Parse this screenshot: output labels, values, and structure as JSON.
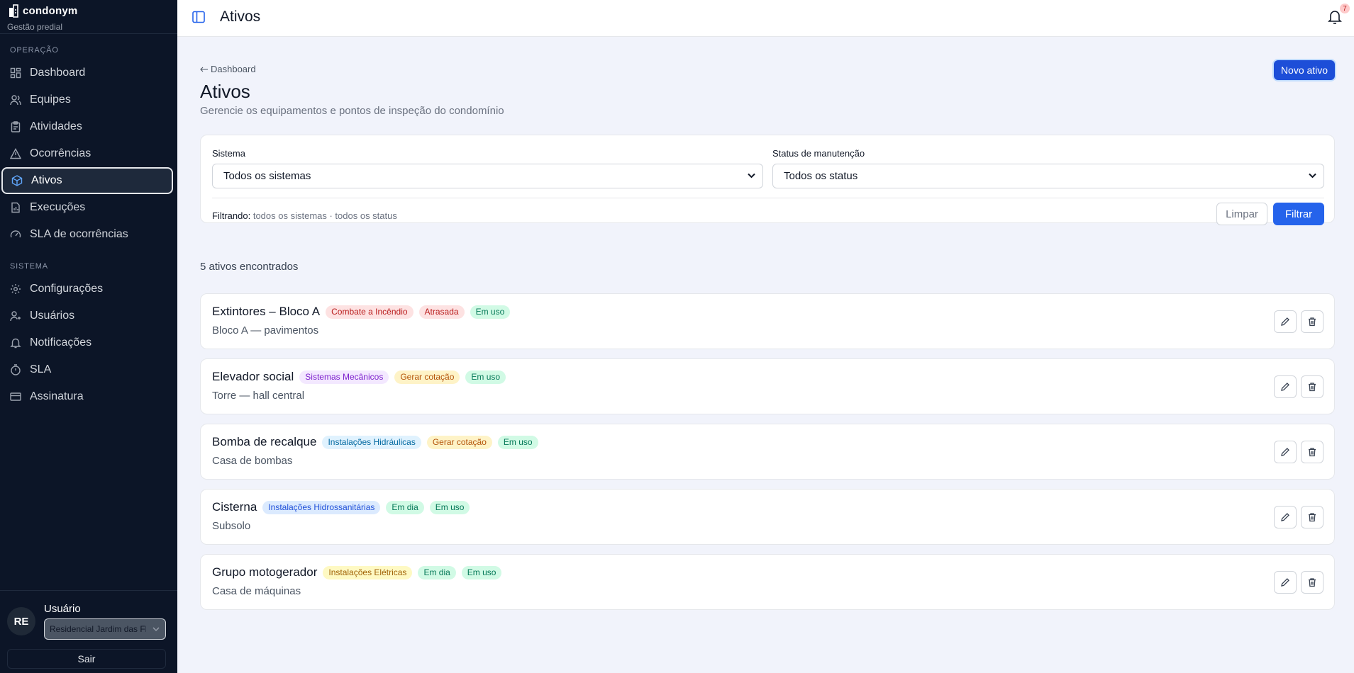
{
  "brand": {
    "name": "condonym",
    "subtitle": "Gestão predial"
  },
  "sidebar": {
    "section_operation": "OPERAÇÃO",
    "section_system": "SISTEMA",
    "items": [
      {
        "label": "Dashboard",
        "icon": "dashboard-icon"
      },
      {
        "label": "Equipes",
        "icon": "users-icon"
      },
      {
        "label": "Atividades",
        "icon": "clipboard-icon"
      },
      {
        "label": "Ocorrências",
        "icon": "warning-icon"
      },
      {
        "label": "Ativos",
        "icon": "box-icon",
        "active": true
      },
      {
        "label": "Execuções",
        "icon": "report-icon"
      },
      {
        "label": "SLA de ocorrências",
        "icon": "gauge-icon"
      },
      {
        "label": "Configurações",
        "icon": "gear-icon"
      },
      {
        "label": "Usuários",
        "icon": "user-icon"
      },
      {
        "label": "Notificações",
        "icon": "bell-icon"
      },
      {
        "label": "SLA",
        "icon": "timer-icon"
      },
      {
        "label": "Assinatura",
        "icon": "card-icon"
      }
    ]
  },
  "user": {
    "initials": "RE",
    "name": "Usuário",
    "condominium": "Residencial Jardim das Flores",
    "logout_label": "Sair"
  },
  "topbar": {
    "title": "Ativos",
    "notification_count": "7"
  },
  "page": {
    "back_label": "Dashboard",
    "title": "Ativos",
    "subtitle": "Gerencie os equipamentos e pontos de inspeção do condomínio",
    "new_button": "Novo ativo"
  },
  "filters": {
    "system_label": "Sistema",
    "system_value": "Todos os sistemas",
    "status_label": "Status de manutenção",
    "status_value": "Todos os status",
    "summary_prefix": "Filtrando:",
    "summary_text": "todos os sistemas · todos os status",
    "clear_label": "Limpar",
    "filter_label": "Filtrar"
  },
  "results": {
    "count_label": "5 ativos encontrados"
  },
  "assets": [
    {
      "name": "Extintores – Bloco A",
      "location": "Bloco A — pavimentos",
      "tags": [
        {
          "text": "Combate a Incêndio",
          "bg": "#fde2e2",
          "fg": "#b91c1c"
        },
        {
          "text": "Atrasada",
          "bg": "#fde2e2",
          "fg": "#b91c1c"
        },
        {
          "text": "Em uso",
          "bg": "#d1fae5",
          "fg": "#047857"
        }
      ]
    },
    {
      "name": "Elevador social",
      "location": "Torre — hall central",
      "tags": [
        {
          "text": "Sistemas Mecânicos",
          "bg": "#f3e8ff",
          "fg": "#7e22ce"
        },
        {
          "text": "Gerar cotação",
          "bg": "#fef3c7",
          "fg": "#b45309"
        },
        {
          "text": "Em uso",
          "bg": "#d1fae5",
          "fg": "#047857"
        }
      ]
    },
    {
      "name": "Bomba de recalque",
      "location": "Casa de bombas",
      "tags": [
        {
          "text": "Instalações Hidráulicas",
          "bg": "#e0f2fe",
          "fg": "#0369a1"
        },
        {
          "text": "Gerar cotação",
          "bg": "#fef3c7",
          "fg": "#b45309"
        },
        {
          "text": "Em uso",
          "bg": "#d1fae5",
          "fg": "#047857"
        }
      ]
    },
    {
      "name": "Cisterna",
      "location": "Subsolo",
      "tags": [
        {
          "text": "Instalações Hidrossanitárias",
          "bg": "#dbeafe",
          "fg": "#1d4ed8"
        },
        {
          "text": "Em dia",
          "bg": "#d1fae5",
          "fg": "#047857"
        },
        {
          "text": "Em uso",
          "bg": "#d1fae5",
          "fg": "#047857"
        }
      ]
    },
    {
      "name": "Grupo motogerador",
      "location": "Casa de máquinas",
      "tags": [
        {
          "text": "Instalações Elétricas",
          "bg": "#fef9c3",
          "fg": "#a16207"
        },
        {
          "text": "Em dia",
          "bg": "#d1fae5",
          "fg": "#047857"
        },
        {
          "text": "Em uso",
          "bg": "#d1fae5",
          "fg": "#047857"
        }
      ]
    }
  ],
  "colors": {
    "sidebar_bg": "#0c1527",
    "primary": "#2563eb",
    "page_bg": "#f1f3fb"
  }
}
